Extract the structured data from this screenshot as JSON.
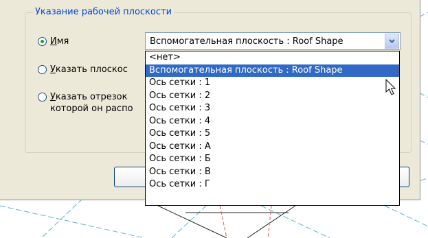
{
  "group": {
    "title": "Указание рабочей плоскости"
  },
  "options": {
    "name_label": "Имя",
    "name_underline": "И",
    "name_rest": "мя",
    "plane_label_prefix": "",
    "plane_underline": "У",
    "plane_rest": "казать плоскос",
    "segment_underline": "У",
    "segment_prefix": "",
    "segment_rest": "казать отрезок",
    "segment_line2": "которой он распо"
  },
  "combo": {
    "selected": "Вспомогательная плоскость : Roof Shape"
  },
  "dropdown": {
    "items": [
      "<нет>",
      "Вспомогательная плоскость : Roof Shape",
      "Ось сетки : 1",
      "Ось сетки : 2",
      "Ось сетки : 3",
      "Ось сетки : 4",
      "Ось сетки : 5",
      "Ось сетки : А",
      "Ось сетки : Б",
      "Ось сетки : В",
      "Ось сетки : Г"
    ],
    "highlighted_index": 1
  },
  "colors": {
    "dialog_bg": "#ece9d8",
    "group_title": "#0046d5",
    "selection": "#316ac5",
    "drawing_lines": "#5bb0d8",
    "drawing_red": "#e05050"
  },
  "icons": {
    "combo_arrow": "chevron-down-icon",
    "cursor": "arrow-cursor-icon"
  }
}
